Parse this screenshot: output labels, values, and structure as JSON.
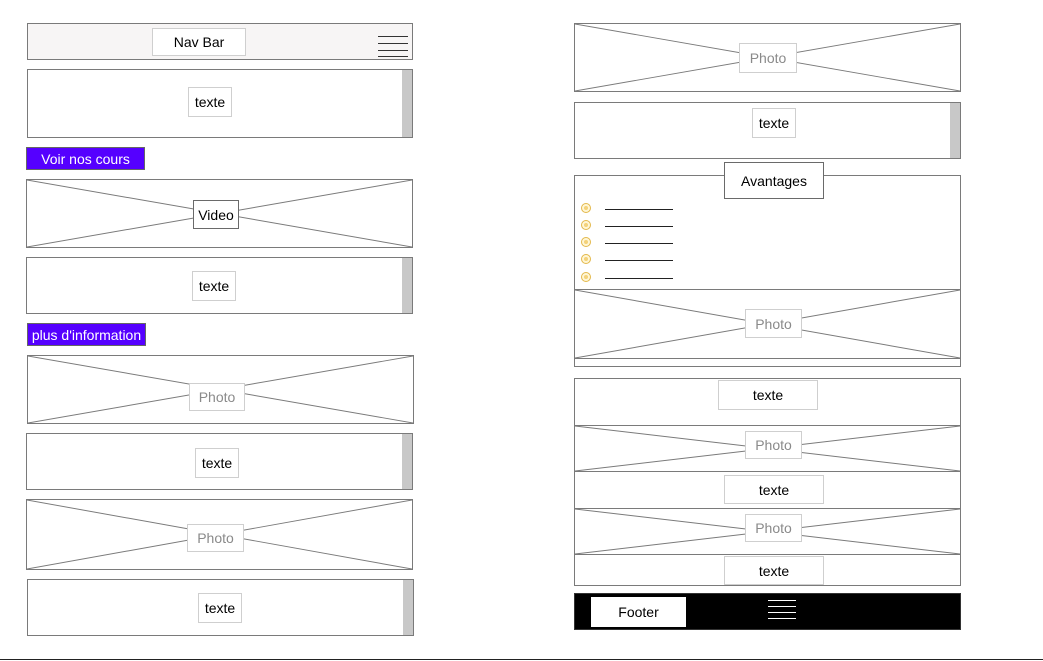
{
  "left": {
    "navbar": {
      "label": "Nav Bar",
      "menu_icon": "hamburger-icon"
    },
    "text1": "texte",
    "button_courses": "Voir nos cours",
    "video": "Video",
    "text2": "texte",
    "button_info": "plus d'information",
    "photo1": "Photo",
    "text3": "texte",
    "photo2": "Photo",
    "text4": "texte"
  },
  "right": {
    "photo_top": "Photo",
    "text_top": "texte",
    "avantages": {
      "title": "Avantages",
      "bullet_icon": "bullet-icon",
      "photo": "Photo"
    },
    "stack": {
      "text1": "texte",
      "photo1": "Photo",
      "text2": "texte",
      "photo2": "Photo",
      "text3": "texte"
    },
    "footer": {
      "label": "Footer",
      "menu_icon": "hamburger-icon"
    }
  },
  "colors": {
    "button_bg": "#5500ff",
    "footer_bg": "#000000",
    "navbar_bg": "#f7f5f5",
    "scrollbar": "#c8c8c8"
  }
}
